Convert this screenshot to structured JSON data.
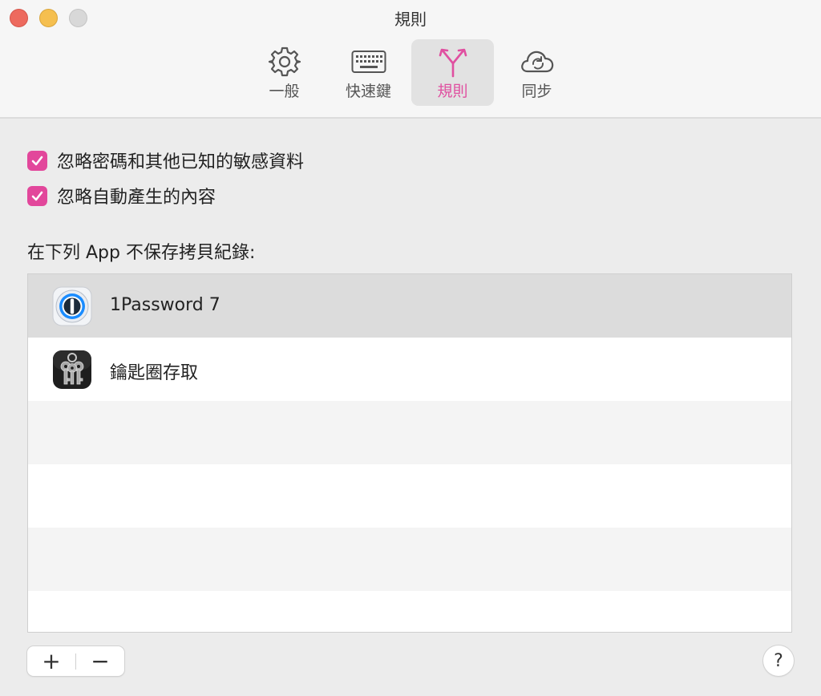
{
  "window": {
    "title": "規則"
  },
  "toolbar": {
    "tabs": [
      {
        "label": "一般",
        "icon": "gear-icon",
        "active": false
      },
      {
        "label": "快速鍵",
        "icon": "keyboard-icon",
        "active": false
      },
      {
        "label": "規則",
        "icon": "branch-icon",
        "active": true
      },
      {
        "label": "同步",
        "icon": "cloud-sync-icon",
        "active": false
      }
    ],
    "accent_color": "#e04fa0"
  },
  "rules": {
    "checkboxes": [
      {
        "label": "忽略密碼和其他已知的敏感資料",
        "checked": true
      },
      {
        "label": "忽略自動產生的內容",
        "checked": true
      }
    ],
    "excluded_apps_label": "在下列 App 不保存拷貝紀錄:",
    "apps": [
      {
        "name": "1Password 7",
        "icon": "1password-icon",
        "selected": true
      },
      {
        "name": "鑰匙圈存取",
        "icon": "keychain-access-icon",
        "selected": false
      }
    ]
  },
  "footer": {
    "add_label": "+",
    "remove_label": "−",
    "help_label": "?"
  }
}
